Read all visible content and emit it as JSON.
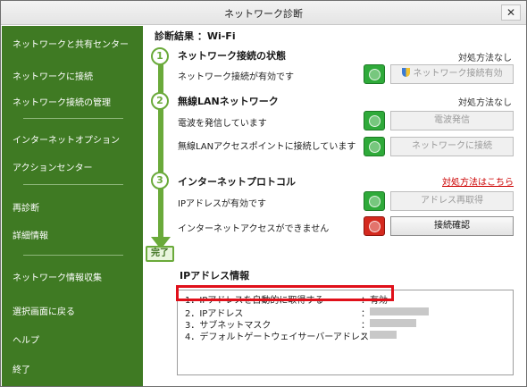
{
  "window": {
    "title": "ネットワーク診断",
    "close_glyph": "✕"
  },
  "sidebar": {
    "items": [
      {
        "label": "ネットワークと共有センター"
      },
      {
        "label": "ネットワークに接続"
      },
      {
        "label": "ネットワーク接続の管理"
      },
      {
        "label": "インターネットオプション"
      },
      {
        "label": "アクションセンター"
      },
      {
        "label": "再診断"
      },
      {
        "label": "詳細情報"
      },
      {
        "label": "ネットワーク情報収集"
      },
      {
        "label": "選択画面に戻る"
      },
      {
        "label": "ヘルプ"
      },
      {
        "label": "終了"
      }
    ]
  },
  "result": {
    "title": "診断結果 ：Wi-Fi"
  },
  "steps": [
    {
      "number": "1",
      "title": "ネットワーク接続の状態",
      "note": "対処方法なし",
      "checks": [
        {
          "label": "ネットワーク接続が有効です",
          "status": "ok",
          "button": "ネットワーク接続有効"
        }
      ]
    },
    {
      "number": "2",
      "title": "無線LANネットワーク",
      "note": "対処方法なし",
      "checks": [
        {
          "label": "電波を発信しています",
          "status": "ok",
          "button": "電波発信"
        },
        {
          "label": "無線LANアクセスポイントに接続しています",
          "status": "ok",
          "button": "ネットワークに接続"
        }
      ]
    },
    {
      "number": "3",
      "title": "インターネットプロトコル",
      "note": "対処方法はこちら",
      "checks": [
        {
          "label": "IPアドレスが有効です",
          "status": "ok",
          "button": "アドレス再取得"
        },
        {
          "label": "インターネットアクセスができません",
          "status": "ng",
          "button": "接続確認"
        }
      ]
    }
  ],
  "done_label": "完了",
  "ip_info": {
    "title": "IPアドレス情報",
    "rows": [
      {
        "label": "1．IPアドレスを自動的に取得する",
        "colon": "：",
        "value": "有効"
      },
      {
        "label": "2．IPアドレス",
        "colon": "：",
        "value": ""
      },
      {
        "label": "3．サブネットマスク",
        "colon": "：",
        "value": ""
      },
      {
        "label": "4．デフォルトゲートウェイサーバーアドレス",
        "colon": "：",
        "value": ""
      }
    ]
  },
  "colors": {
    "sidebar": "#3f7a23",
    "step_green": "#6aaa3a",
    "highlight": "#e0101a",
    "link_red": "#cc0000"
  }
}
